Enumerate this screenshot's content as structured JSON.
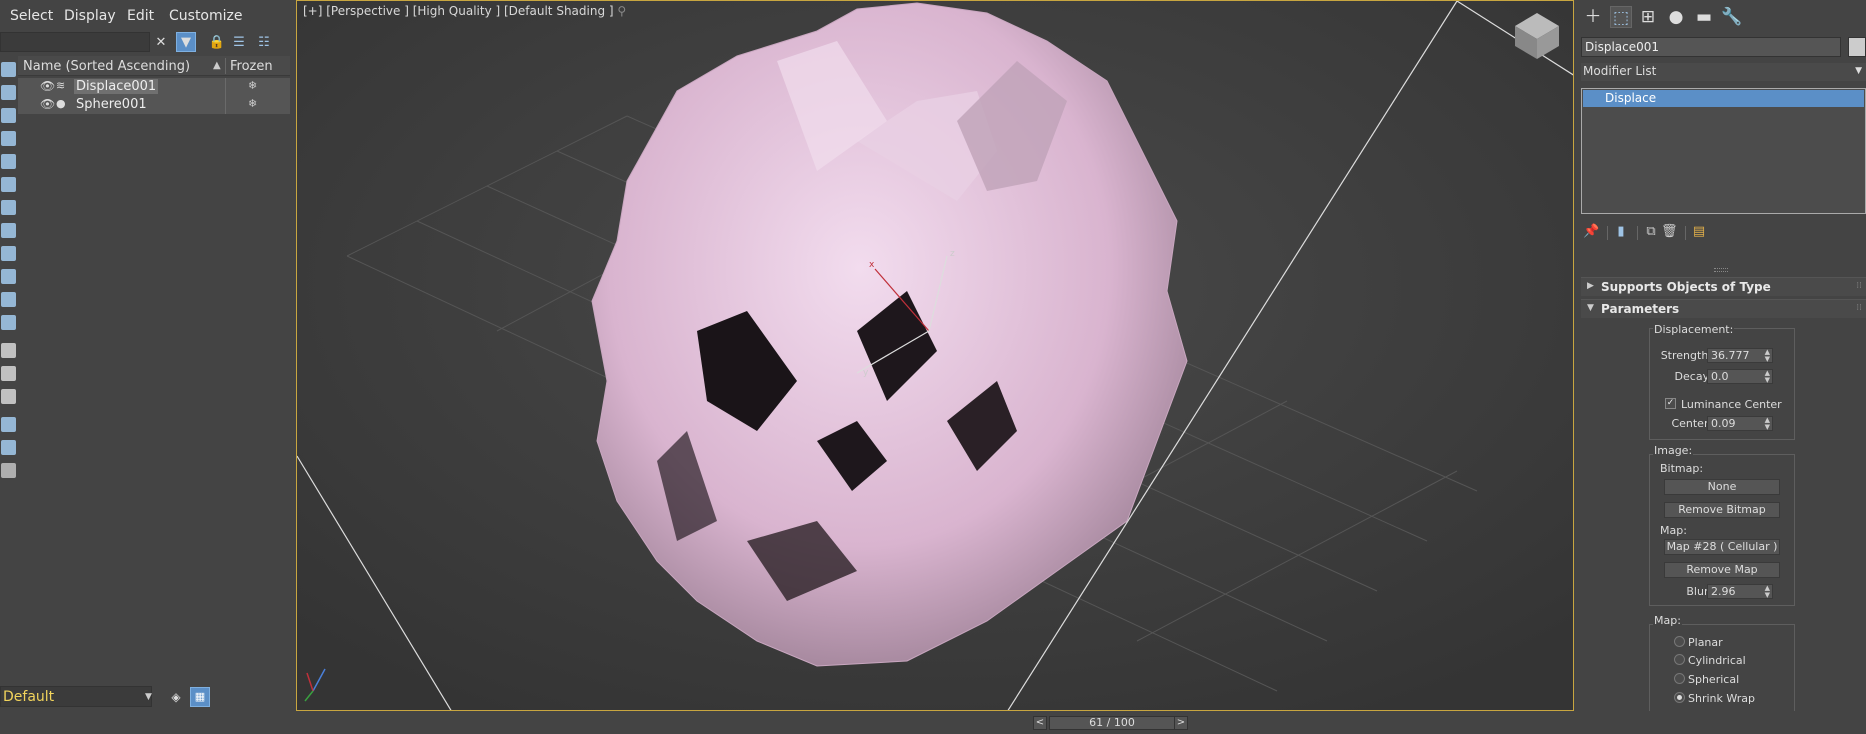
{
  "menubar": {
    "items": [
      "Select",
      "Display",
      "Edit",
      "Customize"
    ]
  },
  "explorer": {
    "search_value": "",
    "columns": {
      "name": "Name (Sorted Ascending)",
      "sort_arrow": "▲",
      "frozen": "Frozen"
    },
    "rows": [
      {
        "name": "Displace001",
        "selected": true
      },
      {
        "name": "Sphere001",
        "selected": false
      }
    ],
    "layer": "Default"
  },
  "viewport": {
    "label": "[+] [Perspective ] [High Quality ] [Default Shading ]",
    "gizmo": {
      "x": "x",
      "y": "y",
      "z": "z"
    },
    "object_color": "#e7c8e0",
    "border_color": "#c8a640"
  },
  "timeslider": {
    "prev": "<",
    "value": "61 / 100",
    "next": ">"
  },
  "command_panel": {
    "object_name": "Displace001",
    "modifier_list": "Modifier List",
    "stack": [
      "Displace"
    ],
    "rollouts": {
      "supports": "Supports Objects of Type",
      "parameters": "Parameters"
    },
    "displacement": {
      "title": "Displacement:",
      "strength_label": "Strength:",
      "strength": "36.777",
      "decay_label": "Decay:",
      "decay": "0.0",
      "luminance_center_label": "Luminance Center",
      "luminance_center_checked": true,
      "center_label": "Center:",
      "center": "0.09"
    },
    "image": {
      "title": "Image:",
      "bitmap_label": "Bitmap:",
      "bitmap_button": "None",
      "remove_bitmap": "Remove Bitmap",
      "map_label": "Map:",
      "map_button": "Map #28  ( Cellular )",
      "remove_map": "Remove Map",
      "blur_label": "Blur:",
      "blur": "2.96"
    },
    "map": {
      "title": "Map:",
      "options": [
        "Planar",
        "Cylindrical",
        "Spherical",
        "Shrink Wrap"
      ],
      "selected": "Shrink Wrap"
    },
    "accent_color": "#5b8fc7"
  }
}
